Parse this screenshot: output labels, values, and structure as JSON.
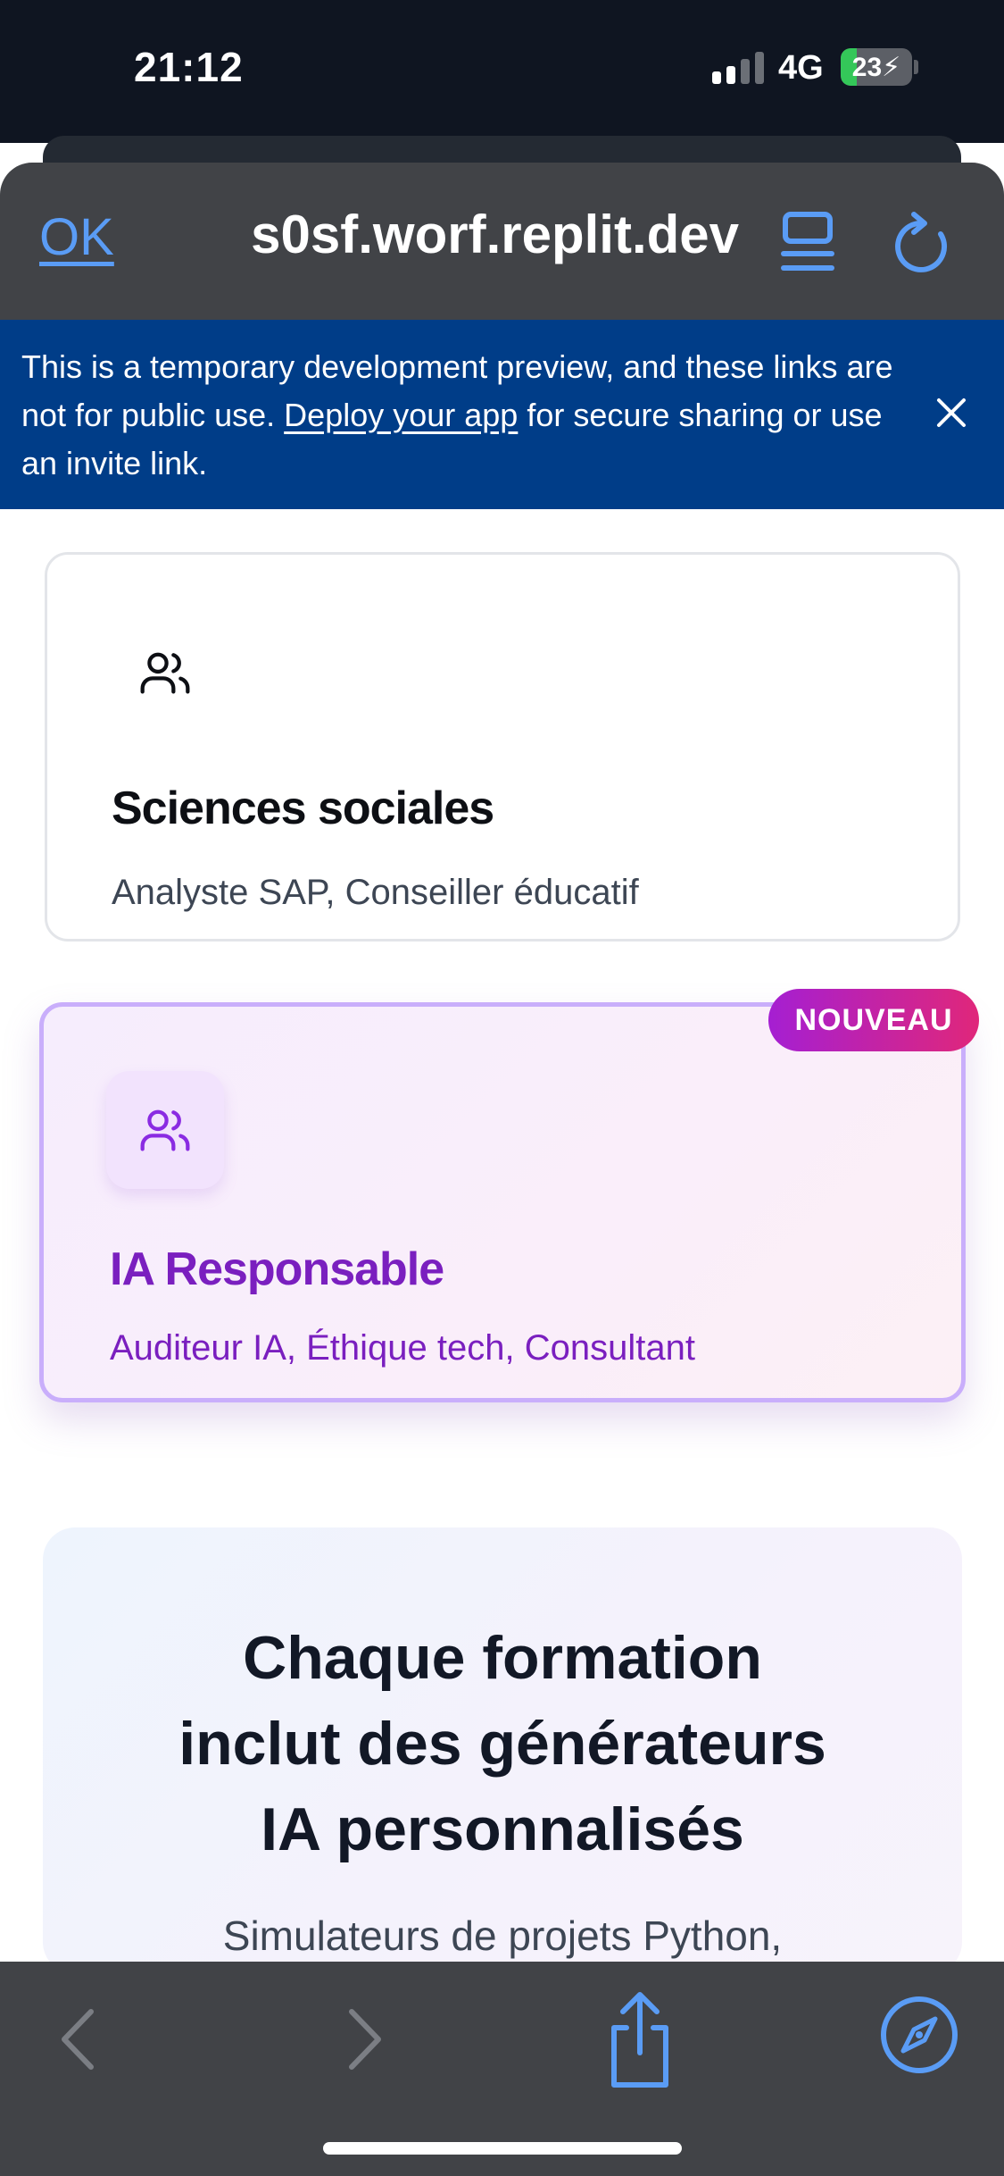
{
  "status_bar": {
    "time": "21:12",
    "network": "4G",
    "battery": "23",
    "battery_level": 0.23,
    "signal_bars_active": 2
  },
  "browser": {
    "done_label": "OK",
    "url": "s0sf.worf.replit.dev",
    "icons": [
      "reader-mode-icon",
      "reload-icon"
    ],
    "accent_color": "#5a9cf5"
  },
  "dev_banner": {
    "text_before": "This is a temporary development preview, and these links are not for public use. ",
    "link": "Deploy your app",
    "text_after": " for secure sharing or use an invite link.",
    "background": "#003d88"
  },
  "cards": [
    {
      "icon": "users-icon",
      "title": "Sciences sociales",
      "subtitle": "Analyste SAP, Conseiller éducatif"
    },
    {
      "icon": "users-icon",
      "title": "IA Responsable",
      "subtitle": "Auditeur IA, Éthique tech, Consultant",
      "badge": "NOUVEAU",
      "accent_color": "#7a1fbf"
    }
  ],
  "feature": {
    "title_line1": "Chaque formation",
    "title_line2": "inclut des générateurs",
    "title_line3": "IA personnalisés",
    "subtitle": "Simulateurs de projets Python,"
  },
  "toolbar": {
    "icons": [
      "back-icon",
      "forward-icon",
      "share-icon",
      "compass-icon"
    ]
  }
}
